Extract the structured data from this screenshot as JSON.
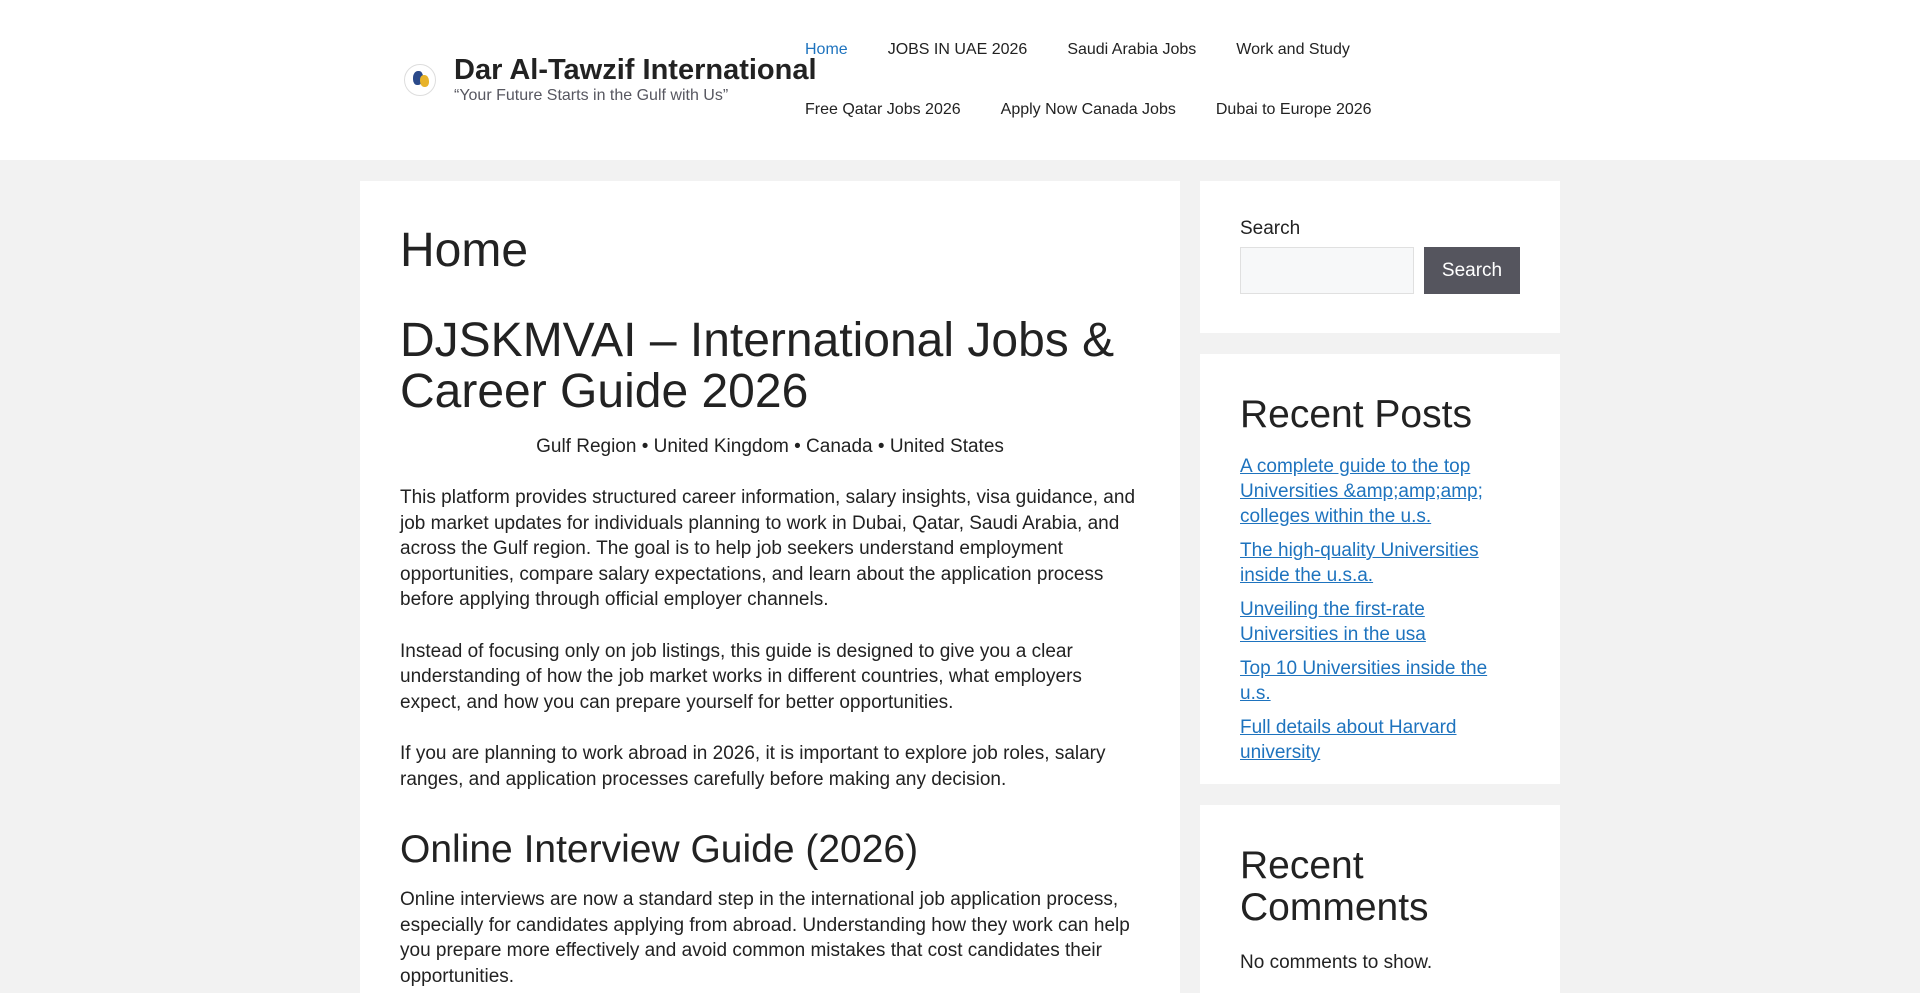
{
  "header": {
    "site_title": "Dar Al-Tawzif International",
    "tagline": "“Your Future Starts in the Gulf with Us”",
    "logo_icon": "globe-logo-icon"
  },
  "nav": {
    "row1": [
      {
        "label": "Home",
        "active": true
      },
      {
        "label": "JOBS IN UAE 2026",
        "active": false
      },
      {
        "label": "Saudi Arabia Jobs",
        "active": false
      },
      {
        "label": "Work and Study",
        "active": false
      }
    ],
    "row2": [
      {
        "label": "Free Qatar Jobs 2026",
        "active": false
      },
      {
        "label": "Apply Now Canada Jobs",
        "active": false
      },
      {
        "label": "Dubai to Europe 2026",
        "active": false
      }
    ]
  },
  "content": {
    "page_title": "Home",
    "hero_heading": "DJSKMVAI – International Jobs & Career Guide 2026",
    "regions": "Gulf Region • United Kingdom • Canada • United States",
    "para1": "This platform provides structured career information, salary insights, visa guidance, and job market updates for individuals planning to work in Dubai, Qatar, Saudi Arabia, and across the Gulf region. The goal is to help job seekers understand employment opportunities, compare salary expectations, and learn about the application process before applying through official employer channels.",
    "para2": "Instead of focusing only on job listings, this guide is designed to give you a clear understanding of how the job market works in different countries, what employers expect, and how you can prepare yourself for better opportunities.",
    "para3": "If you are planning to work abroad in 2026, it is important to explore job roles, salary ranges, and application processes carefully before making any decision.",
    "section_heading": "Online Interview Guide (2026)",
    "para4": "Online interviews are now a standard step in the international job application process, especially for candidates applying from abroad. Understanding how they work can help you prepare more effectively and avoid common mistakes that cost candidates their opportunities."
  },
  "sidebar": {
    "search": {
      "label": "Search",
      "placeholder": "",
      "value": "",
      "button_label": "Search"
    },
    "recent_posts": {
      "title": "Recent Posts",
      "items": [
        "A complete guide to the top Universities &amp;amp;amp; colleges within the u.s.",
        "The high-quality Universities inside the u.s.a.",
        "Unveiling the first-rate Universities in the usa",
        "Top 10 Universities inside the u.s.",
        "Full details about Harvard university"
      ]
    },
    "recent_comments": {
      "title": "Recent Comments",
      "empty_text": "No comments to show."
    }
  },
  "colors": {
    "link": "#1e73be",
    "page_background": "#f2f2f2",
    "button": "#55555e"
  }
}
